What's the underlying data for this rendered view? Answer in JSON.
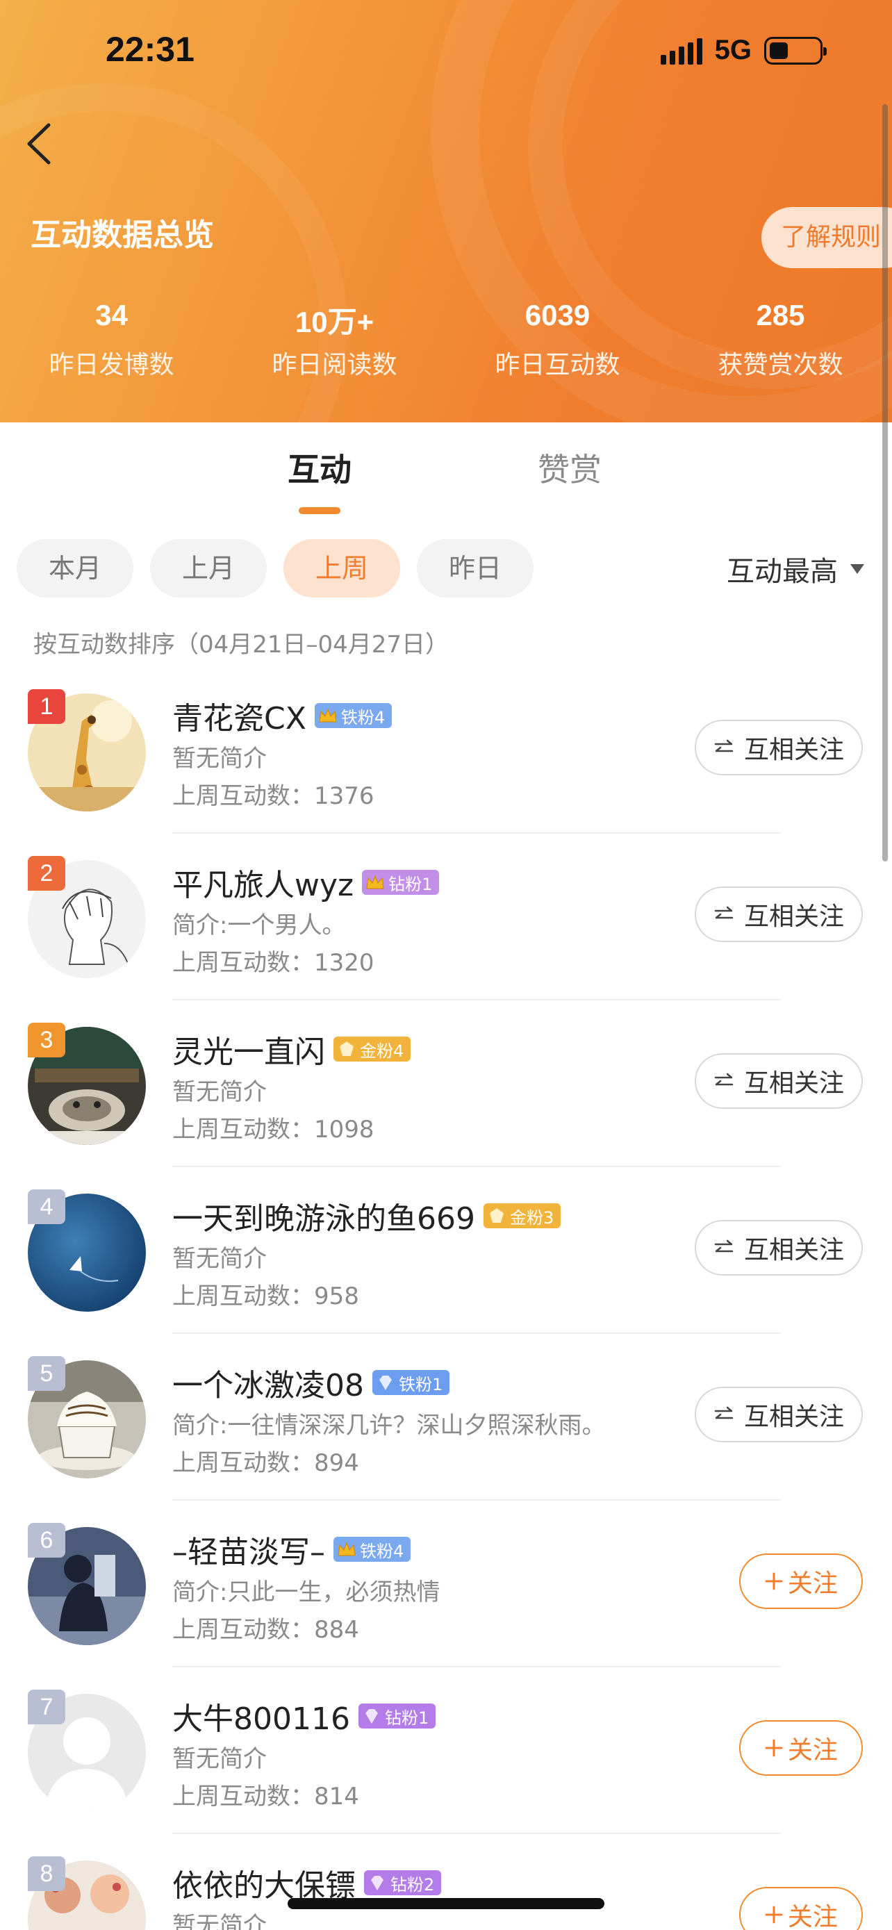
{
  "status": {
    "time": "22:31",
    "network": "5G"
  },
  "header": {
    "title": "互动数据总览",
    "rules_label": "了解规则",
    "stats": [
      {
        "value": "34",
        "label": "昨日发博数"
      },
      {
        "value": "10万+",
        "label": "昨日阅读数"
      },
      {
        "value": "6039",
        "label": "昨日互动数"
      },
      {
        "value": "285",
        "label": "获赞赏次数"
      }
    ]
  },
  "tabs": {
    "active": "互动",
    "inactive": "赞赏"
  },
  "filters": [
    "本月",
    "上月",
    "上周",
    "昨日"
  ],
  "active_filter": "上周",
  "sort_label": "互动最高",
  "sort_note": "按互动数排序（04月21日–04月27日）",
  "colors": {
    "accent": "#f07d2e",
    "rank1": "#e8453c",
    "rank2": "#ef6a3a",
    "rank3": "#f0952e",
    "rank_other": "#b9bfd3"
  },
  "users": [
    {
      "rank": "1",
      "name": "青花瓷CX",
      "badge": "铁粉4",
      "badge_type": "crown-blue",
      "bio": "暂无简介",
      "count": "上周互动数：1376",
      "button": "互相关注",
      "avatar": "giraffe"
    },
    {
      "rank": "2",
      "name": "平凡旅人wyz",
      "badge": "钻粉1",
      "badge_type": "crown-purple",
      "bio": "简介:一个男人。",
      "count": "上周互动数：1320",
      "button": "互相关注",
      "avatar": "sketch"
    },
    {
      "rank": "3",
      "name": "灵光一直闪",
      "badge": "金粉4",
      "badge_type": "gold",
      "bio": "暂无简介",
      "count": "上周互动数：1098",
      "button": "互相关注",
      "avatar": "cat"
    },
    {
      "rank": "4",
      "name": "一天到晚游泳的鱼669",
      "badge": "金粉3",
      "badge_type": "gold",
      "bio": "暂无简介",
      "count": "上周互动数：958",
      "button": "互相关注",
      "avatar": "sea"
    },
    {
      "rank": "5",
      "name": "一个冰激凌08",
      "badge": "铁粉1",
      "badge_type": "diamond-blue",
      "bio": "简介:一往情深深几许？深山夕照深秋雨。",
      "count": "上周互动数：894",
      "button": "互相关注",
      "avatar": "coffee"
    },
    {
      "rank": "6",
      "name": "–轻苗淡写–",
      "badge": "铁粉4",
      "badge_type": "crown-blue",
      "bio": "简介:只此一生，必须热情",
      "count": "上周互动数：884",
      "button": "关注",
      "avatar": "person"
    },
    {
      "rank": "7",
      "name": "大牛800116",
      "badge": "钻粉1",
      "badge_type": "diamond-purple",
      "bio": "暂无简介",
      "count": "上周互动数：814",
      "button": "关注",
      "avatar": "default"
    },
    {
      "rank": "8",
      "name": "依依的大保镖",
      "badge": "钻粉2",
      "badge_type": "diamond-purple",
      "bio": "暂无简介",
      "count": "",
      "button": "关注",
      "avatar": "toys"
    }
  ]
}
